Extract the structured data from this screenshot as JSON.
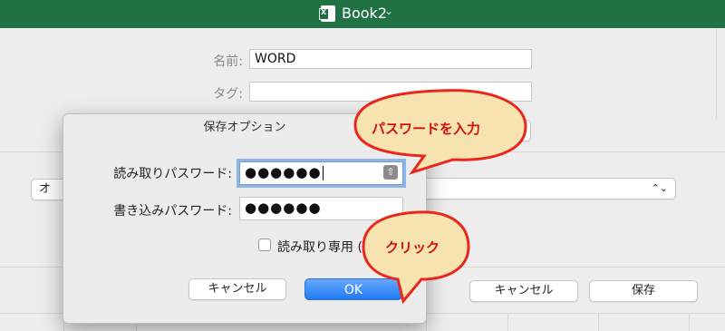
{
  "window": {
    "title": "Book2",
    "chevron": "⌄"
  },
  "save_panel": {
    "name_label": "名前:",
    "name_value": "WORD",
    "tags_label": "タグ:",
    "tags_value": "",
    "format_select_value": "",
    "options_button_partial": "オ",
    "cancel_label": "キャンセル",
    "save_label": "保存"
  },
  "dialog": {
    "title": "保存オプション",
    "read_pw_label": "読み取りパスワード:",
    "read_pw_value": "●●●●●●",
    "write_pw_label": "書き込みパスワード:",
    "write_pw_value": "●●●●●●",
    "readonly_label": "読み取り専用 (",
    "readonly_checked": false,
    "cancel_label": "キャンセル",
    "ok_label": "OK"
  },
  "callouts": {
    "password": "パスワードを入力",
    "click": "クリック"
  },
  "colors": {
    "titlebar": "#207245",
    "callout_fill": "#f6e3b0",
    "callout_border": "#e8281c",
    "ok_button": "#2a7ef5"
  }
}
